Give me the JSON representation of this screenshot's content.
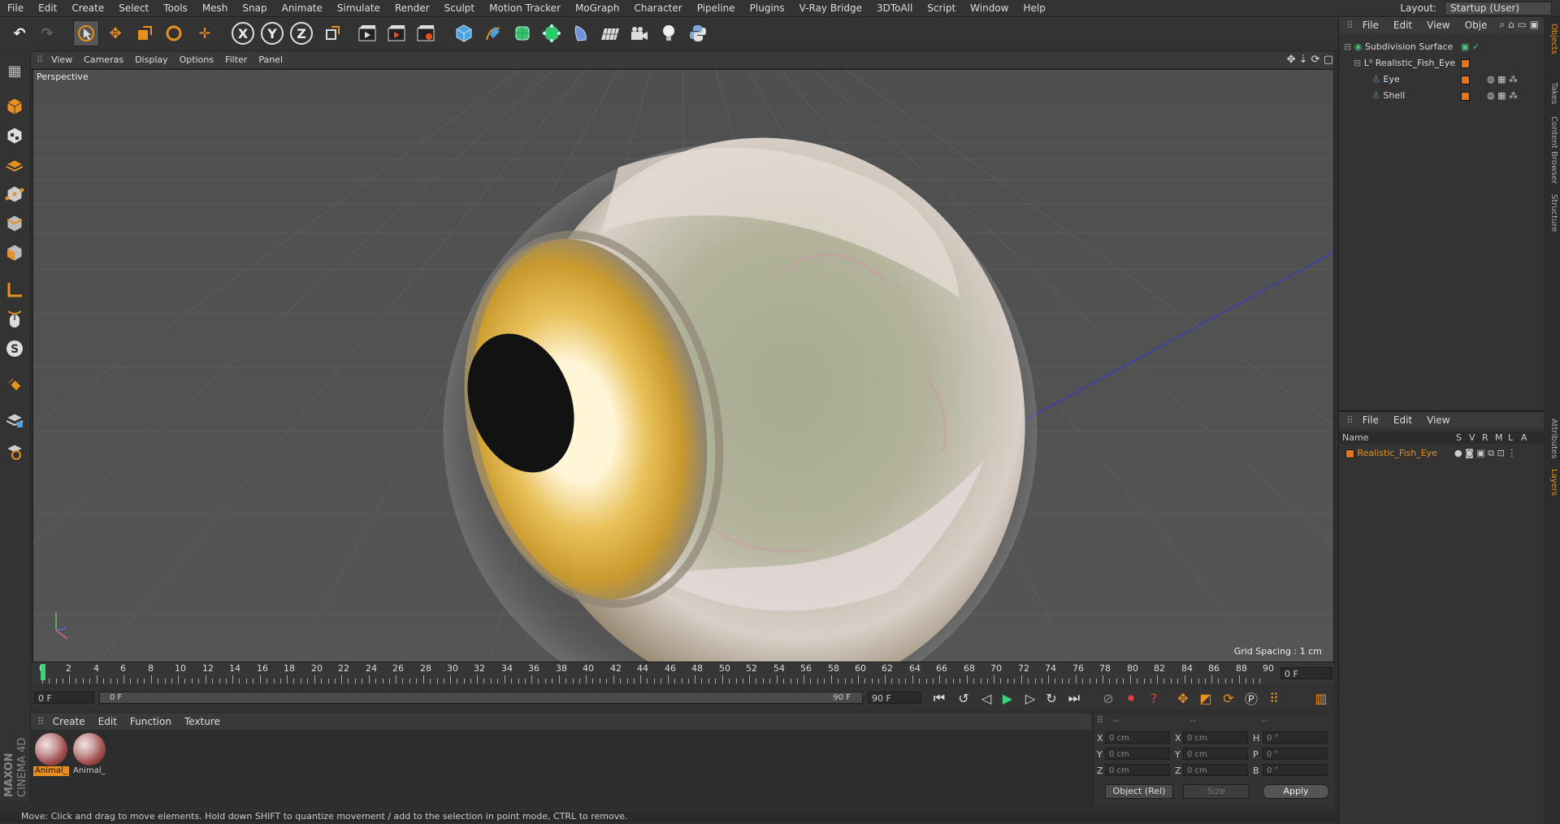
{
  "menubar": {
    "items": [
      "File",
      "Edit",
      "Create",
      "Select",
      "Tools",
      "Mesh",
      "Snap",
      "Animate",
      "Simulate",
      "Render",
      "Sculpt",
      "Motion Tracker",
      "MoGraph",
      "Character",
      "Pipeline",
      "Plugins",
      "V-Ray Bridge",
      "3DToAll",
      "Script",
      "Window",
      "Help"
    ],
    "layout_label": "Layout:",
    "layout_value": "Startup (User)"
  },
  "toolbar": {
    "axis_x": "X",
    "axis_y": "Y",
    "axis_z": "Z"
  },
  "viewport": {
    "menu": [
      "View",
      "Cameras",
      "Display",
      "Options",
      "Filter",
      "Panel"
    ],
    "view_name": "Perspective",
    "grid_spacing": "Grid Spacing : 1 cm"
  },
  "timeline": {
    "ticks": [
      "0",
      "2",
      "4",
      "6",
      "8",
      "10",
      "12",
      "14",
      "16",
      "18",
      "20",
      "22",
      "24",
      "26",
      "28",
      "30",
      "32",
      "34",
      "36",
      "38",
      "40",
      "42",
      "44",
      "46",
      "48",
      "50",
      "52",
      "54",
      "56",
      "58",
      "60",
      "62",
      "64",
      "66",
      "68",
      "70",
      "72",
      "74",
      "76",
      "78",
      "80",
      "82",
      "84",
      "86",
      "88",
      "90"
    ],
    "current_frame": "0 F",
    "start_field": "0 F",
    "range_start": "0 F",
    "range_end": "90 F",
    "end_field": "90 F"
  },
  "materials": {
    "menu": [
      "Create",
      "Edit",
      "Function",
      "Texture"
    ],
    "items": [
      {
        "label": "Animal_",
        "selected": true
      },
      {
        "label": "Animal_",
        "selected": false
      }
    ]
  },
  "coordinates": {
    "header_dashes": [
      "--",
      "--",
      "--"
    ],
    "rows": [
      {
        "a": "X",
        "av": "0 cm",
        "b": "X",
        "bv": "0 cm",
        "c": "H",
        "cv": "0 °"
      },
      {
        "a": "Y",
        "av": "0 cm",
        "b": "Y",
        "bv": "0 cm",
        "c": "P",
        "cv": "0 °"
      },
      {
        "a": "Z",
        "av": "0 cm",
        "b": "Z",
        "bv": "0 cm",
        "c": "B",
        "cv": "0 °"
      }
    ],
    "mode": "Object (Rel)",
    "size": "Size",
    "apply": "Apply"
  },
  "status": "Move: Click and drag to move elements. Hold down SHIFT to quantize movement / add to the selection in point mode, CTRL to remove.",
  "object_manager": {
    "menu": [
      "File",
      "Edit",
      "View",
      "Obje"
    ],
    "objects": [
      "Subdivision Surface",
      "Realistic_Fish_Eye",
      "Eye",
      "Shell"
    ]
  },
  "layer_manager": {
    "menu": [
      "File",
      "Edit",
      "View"
    ],
    "columns": [
      "Name",
      "S",
      "V",
      "R",
      "M",
      "L",
      "A"
    ],
    "layers": [
      "Realistic_Fish_Eye"
    ]
  },
  "side_tabs": [
    "Objects",
    "Takes",
    "Content Browser",
    "Structure",
    "Attributes",
    "Layers"
  ],
  "brand": {
    "maxon": "MAXON",
    "product": "CINEMA 4D"
  },
  "colors": {
    "accent": "#e8901f",
    "viewport_bg": "#4d4d4d"
  }
}
